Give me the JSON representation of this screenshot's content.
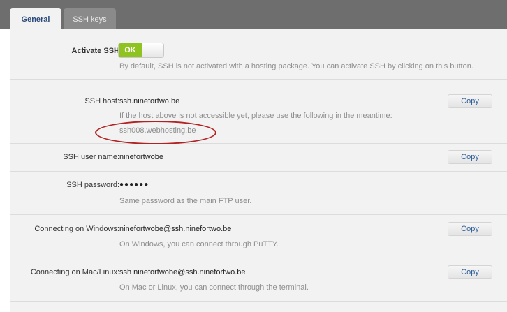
{
  "tabs": [
    {
      "label": "General",
      "active": true
    },
    {
      "label": "SSH keys",
      "active": false
    }
  ],
  "activate": {
    "label": "Activate SSH",
    "toggle_label": "OK",
    "toggle_on": true,
    "hint": "By default, SSH is not activated with a hosting package. You can activate SSH by clicking on this button."
  },
  "host": {
    "label": "SSH host:",
    "value": "ssh.ninefortwo.be",
    "hint": "If the host above is not accessible yet, please use the following in the meantime:",
    "alt_host": "ssh008.webhosting.be",
    "copy_label": "Copy"
  },
  "username": {
    "label": "SSH user name:",
    "value": "ninefortwobe",
    "copy_label": "Copy"
  },
  "password": {
    "label": "SSH password:",
    "value": "●●●●●●",
    "hint": "Same password as the main FTP user."
  },
  "windows": {
    "label": "Connecting on Windows:",
    "value": "ninefortwobe@ssh.ninefortwo.be",
    "hint": "On Windows, you can connect through PuTTY.",
    "copy_label": "Copy"
  },
  "maclinux": {
    "label": "Connecting on Mac/Linux:",
    "value": "ssh ninefortwobe@ssh.ninefortwo.be",
    "hint": "On Mac or Linux, you can connect through the terminal.",
    "copy_label": "Copy"
  },
  "colors": {
    "accent": "#2f5f9a",
    "toggle_on": "#8fc31f",
    "annotation": "#b22222"
  }
}
